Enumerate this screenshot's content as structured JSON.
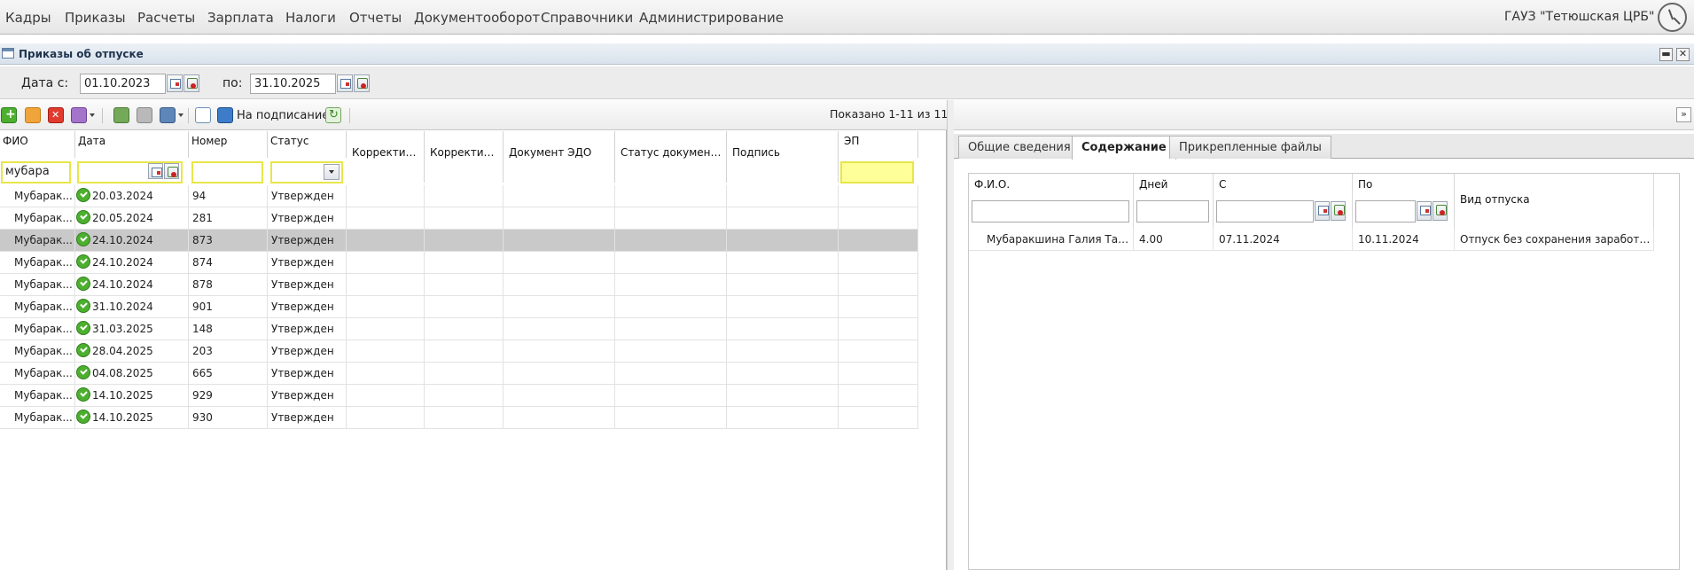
{
  "menu": [
    "Кадры",
    "Приказы",
    "Расчеты",
    "Зарплата",
    "Налоги",
    "Отчеты",
    "Документооборот",
    "Справочники",
    "Администрирование"
  ],
  "organization": "ГАУЗ \"Тетюшская ЦРБ\"",
  "window": {
    "title": "Приказы об отпуске",
    "minimize": "▬",
    "close": "✕"
  },
  "dates": {
    "from_label": "Дата с:",
    "from_value": "01.10.2023",
    "to_label": "по:",
    "to_value": "31.10.2025"
  },
  "toolbar": {
    "sign_label": "На подписание",
    "shown": "Показано 1-11 из 11"
  },
  "grid": {
    "columns": [
      "ФИО",
      "Дата",
      "Номер",
      "Статус",
      "Корректир...",
      "Корректир...",
      "Документ ЭДО",
      "Статус документ...",
      "Подпись",
      "ЭП"
    ],
    "filters": {
      "fio": "мубара",
      "date": "",
      "number": "",
      "status": "",
      "ep": ""
    },
    "rows": [
      {
        "fio": "Мубарак...",
        "date": "20.03.2024",
        "number": "94",
        "status": "Утвержден"
      },
      {
        "fio": "Мубарак...",
        "date": "20.05.2024",
        "number": "281",
        "status": "Утвержден"
      },
      {
        "fio": "Мубарак...",
        "date": "24.10.2024",
        "number": "873",
        "status": "Утвержден"
      },
      {
        "fio": "Мубарак...",
        "date": "24.10.2024",
        "number": "874",
        "status": "Утвержден"
      },
      {
        "fio": "Мубарак...",
        "date": "24.10.2024",
        "number": "878",
        "status": "Утвержден"
      },
      {
        "fio": "Мубарак...",
        "date": "31.10.2024",
        "number": "901",
        "status": "Утвержден"
      },
      {
        "fio": "Мубарак...",
        "date": "31.03.2025",
        "number": "148",
        "status": "Утвержден"
      },
      {
        "fio": "Мубарак...",
        "date": "28.04.2025",
        "number": "203",
        "status": "Утвержден"
      },
      {
        "fio": "Мубарак...",
        "date": "04.08.2025",
        "number": "665",
        "status": "Утвержден"
      },
      {
        "fio": "Мубарак...",
        "date": "14.10.2025",
        "number": "929",
        "status": "Утвержден"
      },
      {
        "fio": "Мубарак...",
        "date": "14.10.2025",
        "number": "930",
        "status": "Утвержден"
      }
    ]
  },
  "right": {
    "collapse_icon": "»",
    "tabs": [
      "Общие сведения",
      "Содержание",
      "Прикрепленные файлы"
    ],
    "columns": [
      "Ф.И.О.",
      "Дней",
      "С",
      "По",
      "Вид отпуска"
    ],
    "rows": [
      {
        "fio": "Мубаракшина Галия Тау...",
        "days": "4.00",
        "from": "07.11.2024",
        "to": "10.11.2024",
        "kind": "Отпуск без сохранения заработн..."
      }
    ]
  }
}
